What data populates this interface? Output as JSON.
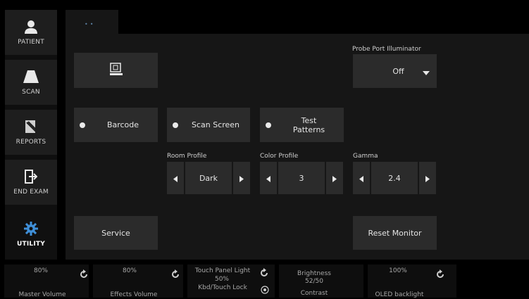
{
  "sidebar": {
    "items": [
      {
        "label": "PATIENT",
        "icon": "patient-icon"
      },
      {
        "label": "SCAN",
        "icon": "scan-icon"
      },
      {
        "label": "REPORTS",
        "icon": "reports-icon"
      },
      {
        "label": "END EXAM",
        "icon": "end-exam-icon"
      },
      {
        "label": "UTILITY",
        "icon": "utility-gear-icon",
        "active": true
      }
    ]
  },
  "tab": {
    "dots": "••"
  },
  "probe_port": {
    "label": "Probe Port Illuminator",
    "value": "Off"
  },
  "radio_buttons": [
    {
      "label": "Barcode"
    },
    {
      "label": "Scan Screen"
    },
    {
      "label_line1": "Test",
      "label_line2": "Patterns"
    }
  ],
  "room_profile": {
    "label": "Room Profile",
    "value": "Dark"
  },
  "color_profile": {
    "label": "Color Profile",
    "value": "3"
  },
  "gamma": {
    "label": "Gamma",
    "value": "2.4"
  },
  "service_button": "Service",
  "reset_monitor_button": "Reset Monitor",
  "bottom_bar": {
    "master_volume": {
      "value": "80%",
      "label": "Master Volume"
    },
    "effects_volume": {
      "value": "80%",
      "label": "Effects Volume"
    },
    "touch_panel_light": {
      "title": "Touch Panel Light",
      "value": "50%",
      "label": "Kbd/Touch Lock"
    },
    "brightness": {
      "title": "Brightness",
      "value": "52/50",
      "label": "Contrast"
    },
    "oled_backlight": {
      "value": "100%",
      "label": "OLED backlight"
    }
  },
  "colors": {
    "accent": "#3f8fd8",
    "panel": "#161616",
    "button": "#2b2b2b"
  }
}
